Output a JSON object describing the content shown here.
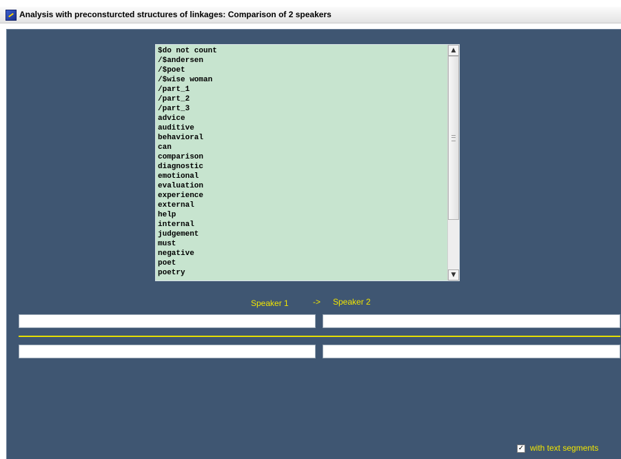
{
  "window": {
    "title": "Analysis with preconsturcted structures of linkages: Comparison of 2 speakers"
  },
  "category_list": {
    "items": [
      "$do not count",
      "/$andersen",
      "/$poet",
      "/$wise woman",
      "/part_1",
      "/part_2",
      "/part_3",
      "advice",
      "auditive",
      "behavioral",
      "can",
      "comparison",
      "diagnostic",
      "emotional",
      "evaluation",
      "experience",
      "external",
      "help",
      "internal",
      "judgement",
      "must",
      "negative",
      "poet",
      "poetry"
    ]
  },
  "labels": {
    "speaker1": "Speaker 1",
    "arrow": "->",
    "speaker2": "Speaker 2"
  },
  "fields": {
    "speaker1_top": "",
    "speaker2_top": "",
    "speaker1_bottom": "",
    "speaker2_bottom": ""
  },
  "options": {
    "with_text_segments_label": "with text segments",
    "with_text_segments_checked": true,
    "check_mark": "✓"
  },
  "icons": {
    "app": "app-icon",
    "scroll_up": "scroll-up-arrow-icon",
    "scroll_down": "scroll-down-arrow-icon"
  },
  "colors": {
    "panel_background": "#3f5672",
    "list_background": "#c7e4cf",
    "label_yellow": "#f2e600",
    "divider_yellow": "#e6df00"
  }
}
